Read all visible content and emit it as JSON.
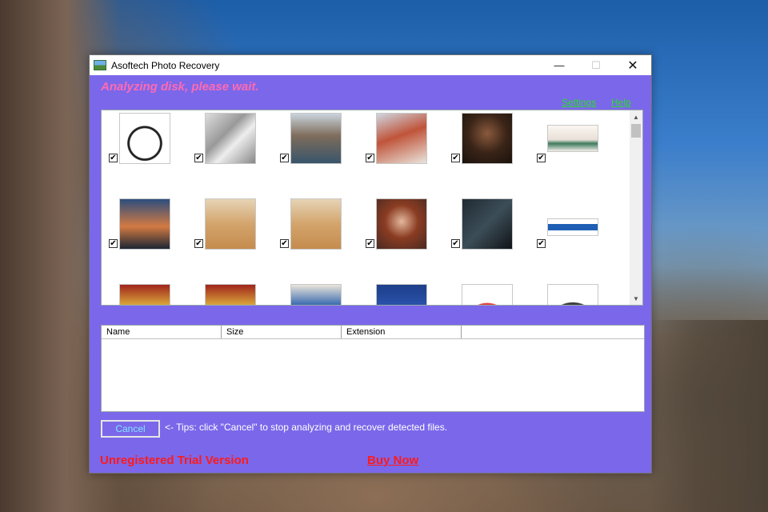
{
  "window": {
    "title": "Asoftech Photo Recovery",
    "controls": {
      "minimize": "—",
      "maximize": "☐",
      "close": "✕"
    }
  },
  "status_text": "Analyzing disk, please wait.",
  "links": {
    "settings": "Settings",
    "help": "Help"
  },
  "gallery": {
    "thumbnails": [
      {
        "desc": "ring-sketch-icon",
        "checked": true
      },
      {
        "desc": "album-cover-icon",
        "checked": true
      },
      {
        "desc": "woman-sunglasses-icon",
        "checked": true
      },
      {
        "desc": "redhead-woman-icon",
        "checked": true
      },
      {
        "desc": "portrait-dark-icon",
        "checked": true
      },
      {
        "desc": "desk-flatlay-icon",
        "checked": true
      },
      {
        "desc": "sunset-runner-icon",
        "checked": true
      },
      {
        "desc": "wheat-field-woman-icon",
        "checked": true
      },
      {
        "desc": "wheat-field-woman-icon",
        "checked": true
      },
      {
        "desc": "redhead-portrait-icon",
        "checked": true
      },
      {
        "desc": "suited-man-icon",
        "checked": true
      },
      {
        "desc": "web-banner-icon",
        "checked": true
      },
      {
        "desc": "red-portrait-icon",
        "checked": false
      },
      {
        "desc": "red-portrait-icon",
        "checked": false
      },
      {
        "desc": "magazine-cover-icon",
        "checked": false
      },
      {
        "desc": "blue-poster-icon",
        "checked": false
      },
      {
        "desc": "red-circle-logo-icon",
        "checked": false
      },
      {
        "desc": "orange-button-logo-icon",
        "checked": false
      }
    ],
    "check_glyph": "✔"
  },
  "file_table": {
    "columns": [
      "Name",
      "Size",
      "Extension",
      ""
    ],
    "rows": []
  },
  "cancel_button": "Cancel",
  "tips": "<- Tips: click \"Cancel\" to stop analyzing and recover detected files.",
  "trial_text": "Unregistered Trial Version",
  "buy_now": "Buy Now",
  "colors": {
    "window_bg": "#7b67ea",
    "status_pink": "#ff6ab3",
    "link_green": "#28e028",
    "warning_red": "#ff1a1a",
    "cancel_text": "#7fe6ff"
  }
}
